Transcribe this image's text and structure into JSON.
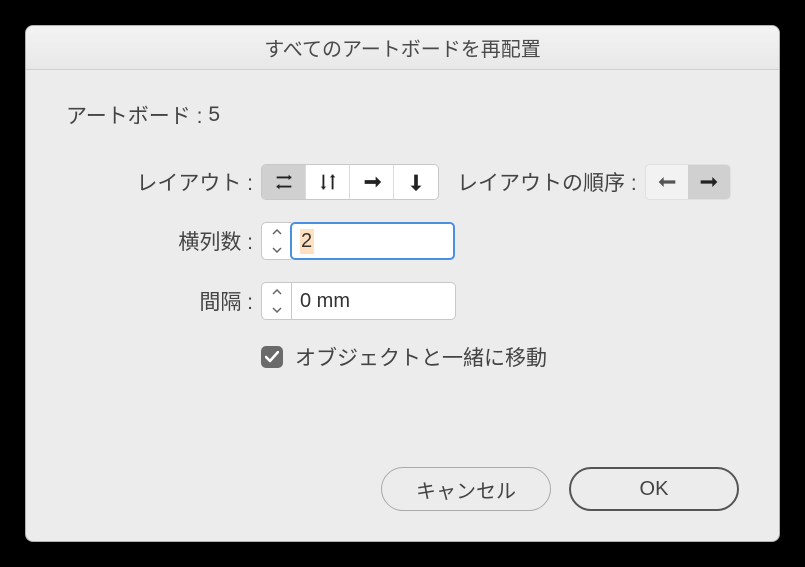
{
  "dialog": {
    "title": "すべてのアートボードを再配置",
    "artboards_label": "アートボード :",
    "artboards_count": "5",
    "layout_label": "レイアウト :",
    "layout_order_label": "レイアウトの順序 :",
    "columns_label": "横列数 :",
    "columns_value": "2",
    "spacing_label": "間隔 :",
    "spacing_value": "0 mm",
    "checkbox_label": "オブジェクトと一緒に移動",
    "checkbox_checked": true,
    "cancel_label": "キャンセル",
    "ok_label": "OK",
    "layout_selected": 0,
    "order_selected": 1
  }
}
